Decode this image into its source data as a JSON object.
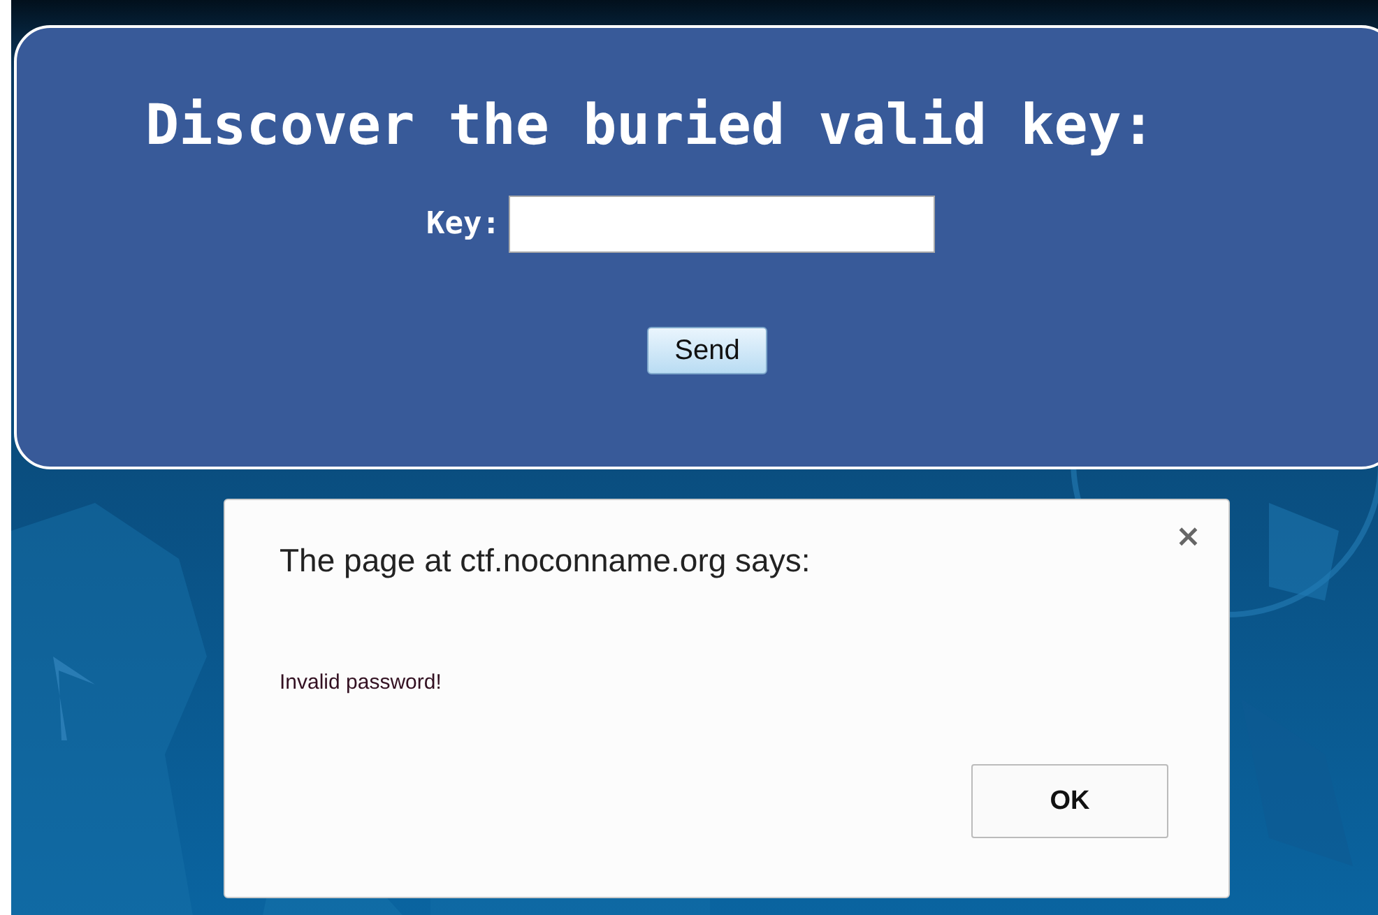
{
  "page": {
    "heading": "Discover the buried valid key:",
    "key_label": "Key:",
    "send_button": "Send"
  },
  "dialog": {
    "title": "The page at ctf.noconname.org says:",
    "close": "×",
    "message": "Invalid password!",
    "buttons": [
      "OK"
    ]
  }
}
